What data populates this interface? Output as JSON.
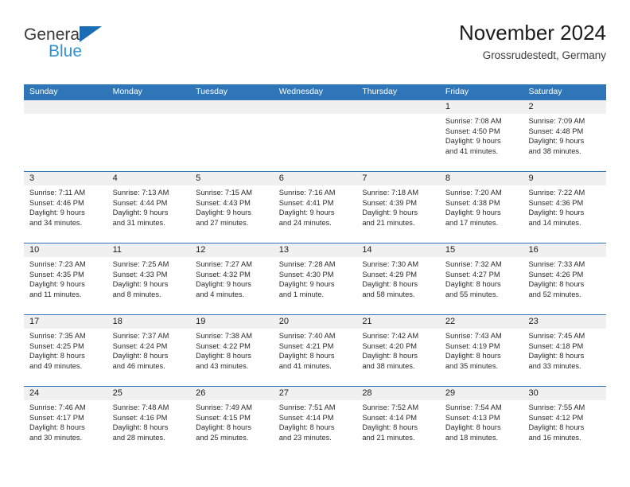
{
  "brand": {
    "name_top": "General",
    "name_bottom": "Blue"
  },
  "header": {
    "title": "November 2024",
    "subtitle": "Grossrudestedt, Germany",
    "accent_color": "#2e76b8",
    "daynum_band_color": "#f0f0f0"
  },
  "weekdays": [
    "Sunday",
    "Monday",
    "Tuesday",
    "Wednesday",
    "Thursday",
    "Friday",
    "Saturday"
  ],
  "weeks": [
    [
      {
        "day": "",
        "empty": true
      },
      {
        "day": "",
        "empty": true
      },
      {
        "day": "",
        "empty": true
      },
      {
        "day": "",
        "empty": true
      },
      {
        "day": "",
        "empty": true
      },
      {
        "day": "1",
        "sunrise": "Sunrise: 7:08 AM",
        "sunset": "Sunset: 4:50 PM",
        "daylight_1": "Daylight: 9 hours",
        "daylight_2": "and 41 minutes."
      },
      {
        "day": "2",
        "sunrise": "Sunrise: 7:09 AM",
        "sunset": "Sunset: 4:48 PM",
        "daylight_1": "Daylight: 9 hours",
        "daylight_2": "and 38 minutes."
      }
    ],
    [
      {
        "day": "3",
        "sunrise": "Sunrise: 7:11 AM",
        "sunset": "Sunset: 4:46 PM",
        "daylight_1": "Daylight: 9 hours",
        "daylight_2": "and 34 minutes."
      },
      {
        "day": "4",
        "sunrise": "Sunrise: 7:13 AM",
        "sunset": "Sunset: 4:44 PM",
        "daylight_1": "Daylight: 9 hours",
        "daylight_2": "and 31 minutes."
      },
      {
        "day": "5",
        "sunrise": "Sunrise: 7:15 AM",
        "sunset": "Sunset: 4:43 PM",
        "daylight_1": "Daylight: 9 hours",
        "daylight_2": "and 27 minutes."
      },
      {
        "day": "6",
        "sunrise": "Sunrise: 7:16 AM",
        "sunset": "Sunset: 4:41 PM",
        "daylight_1": "Daylight: 9 hours",
        "daylight_2": "and 24 minutes."
      },
      {
        "day": "7",
        "sunrise": "Sunrise: 7:18 AM",
        "sunset": "Sunset: 4:39 PM",
        "daylight_1": "Daylight: 9 hours",
        "daylight_2": "and 21 minutes."
      },
      {
        "day": "8",
        "sunrise": "Sunrise: 7:20 AM",
        "sunset": "Sunset: 4:38 PM",
        "daylight_1": "Daylight: 9 hours",
        "daylight_2": "and 17 minutes."
      },
      {
        "day": "9",
        "sunrise": "Sunrise: 7:22 AM",
        "sunset": "Sunset: 4:36 PM",
        "daylight_1": "Daylight: 9 hours",
        "daylight_2": "and 14 minutes."
      }
    ],
    [
      {
        "day": "10",
        "sunrise": "Sunrise: 7:23 AM",
        "sunset": "Sunset: 4:35 PM",
        "daylight_1": "Daylight: 9 hours",
        "daylight_2": "and 11 minutes."
      },
      {
        "day": "11",
        "sunrise": "Sunrise: 7:25 AM",
        "sunset": "Sunset: 4:33 PM",
        "daylight_1": "Daylight: 9 hours",
        "daylight_2": "and 8 minutes."
      },
      {
        "day": "12",
        "sunrise": "Sunrise: 7:27 AM",
        "sunset": "Sunset: 4:32 PM",
        "daylight_1": "Daylight: 9 hours",
        "daylight_2": "and 4 minutes."
      },
      {
        "day": "13",
        "sunrise": "Sunrise: 7:28 AM",
        "sunset": "Sunset: 4:30 PM",
        "daylight_1": "Daylight: 9 hours",
        "daylight_2": "and 1 minute."
      },
      {
        "day": "14",
        "sunrise": "Sunrise: 7:30 AM",
        "sunset": "Sunset: 4:29 PM",
        "daylight_1": "Daylight: 8 hours",
        "daylight_2": "and 58 minutes."
      },
      {
        "day": "15",
        "sunrise": "Sunrise: 7:32 AM",
        "sunset": "Sunset: 4:27 PM",
        "daylight_1": "Daylight: 8 hours",
        "daylight_2": "and 55 minutes."
      },
      {
        "day": "16",
        "sunrise": "Sunrise: 7:33 AM",
        "sunset": "Sunset: 4:26 PM",
        "daylight_1": "Daylight: 8 hours",
        "daylight_2": "and 52 minutes."
      }
    ],
    [
      {
        "day": "17",
        "sunrise": "Sunrise: 7:35 AM",
        "sunset": "Sunset: 4:25 PM",
        "daylight_1": "Daylight: 8 hours",
        "daylight_2": "and 49 minutes."
      },
      {
        "day": "18",
        "sunrise": "Sunrise: 7:37 AM",
        "sunset": "Sunset: 4:24 PM",
        "daylight_1": "Daylight: 8 hours",
        "daylight_2": "and 46 minutes."
      },
      {
        "day": "19",
        "sunrise": "Sunrise: 7:38 AM",
        "sunset": "Sunset: 4:22 PM",
        "daylight_1": "Daylight: 8 hours",
        "daylight_2": "and 43 minutes."
      },
      {
        "day": "20",
        "sunrise": "Sunrise: 7:40 AM",
        "sunset": "Sunset: 4:21 PM",
        "daylight_1": "Daylight: 8 hours",
        "daylight_2": "and 41 minutes."
      },
      {
        "day": "21",
        "sunrise": "Sunrise: 7:42 AM",
        "sunset": "Sunset: 4:20 PM",
        "daylight_1": "Daylight: 8 hours",
        "daylight_2": "and 38 minutes."
      },
      {
        "day": "22",
        "sunrise": "Sunrise: 7:43 AM",
        "sunset": "Sunset: 4:19 PM",
        "daylight_1": "Daylight: 8 hours",
        "daylight_2": "and 35 minutes."
      },
      {
        "day": "23",
        "sunrise": "Sunrise: 7:45 AM",
        "sunset": "Sunset: 4:18 PM",
        "daylight_1": "Daylight: 8 hours",
        "daylight_2": "and 33 minutes."
      }
    ],
    [
      {
        "day": "24",
        "sunrise": "Sunrise: 7:46 AM",
        "sunset": "Sunset: 4:17 PM",
        "daylight_1": "Daylight: 8 hours",
        "daylight_2": "and 30 minutes."
      },
      {
        "day": "25",
        "sunrise": "Sunrise: 7:48 AM",
        "sunset": "Sunset: 4:16 PM",
        "daylight_1": "Daylight: 8 hours",
        "daylight_2": "and 28 minutes."
      },
      {
        "day": "26",
        "sunrise": "Sunrise: 7:49 AM",
        "sunset": "Sunset: 4:15 PM",
        "daylight_1": "Daylight: 8 hours",
        "daylight_2": "and 25 minutes."
      },
      {
        "day": "27",
        "sunrise": "Sunrise: 7:51 AM",
        "sunset": "Sunset: 4:14 PM",
        "daylight_1": "Daylight: 8 hours",
        "daylight_2": "and 23 minutes."
      },
      {
        "day": "28",
        "sunrise": "Sunrise: 7:52 AM",
        "sunset": "Sunset: 4:14 PM",
        "daylight_1": "Daylight: 8 hours",
        "daylight_2": "and 21 minutes."
      },
      {
        "day": "29",
        "sunrise": "Sunrise: 7:54 AM",
        "sunset": "Sunset: 4:13 PM",
        "daylight_1": "Daylight: 8 hours",
        "daylight_2": "and 18 minutes."
      },
      {
        "day": "30",
        "sunrise": "Sunrise: 7:55 AM",
        "sunset": "Sunset: 4:12 PM",
        "daylight_1": "Daylight: 8 hours",
        "daylight_2": "and 16 minutes."
      }
    ]
  ]
}
